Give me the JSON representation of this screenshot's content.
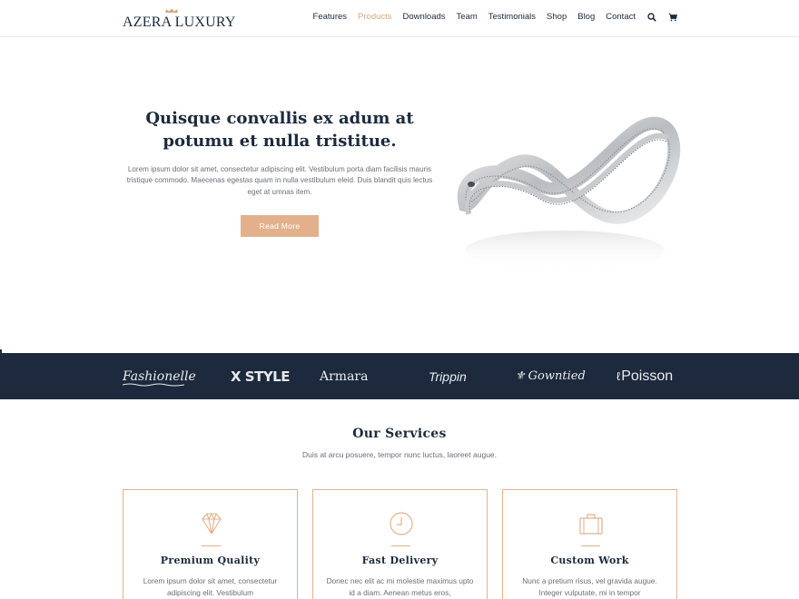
{
  "brand": {
    "logo_text": "AZERA LUXURY",
    "logo_icon": "crown-icon",
    "accent_color": "#e2b18c",
    "navy_color": "#1d2a3d"
  },
  "nav": {
    "items": [
      {
        "label": "Features"
      },
      {
        "label": "Products",
        "active": true
      },
      {
        "label": "Downloads"
      },
      {
        "label": "Team"
      },
      {
        "label": "Testimonials"
      },
      {
        "label": "Shop"
      },
      {
        "label": "Blog"
      },
      {
        "label": "Contact"
      }
    ],
    "search_icon": "search-icon",
    "cart_icon": "cart-icon"
  },
  "hero": {
    "title": "Quisque convallis ex adum at potumu et nulla tristitue.",
    "text": "Lorem ipsum dolor sit amet, consectetur adipiscing elit. Vestibulum porta diam facilisis mauris tristique commodo. Maecenas egestas quam in nulla vestibulum eleid. Duis blandit quis lectus eget at umnas item.",
    "button_label": "Read More",
    "image": "diamond-ring-image"
  },
  "brands": [
    "Fashionelle",
    "X STYLE",
    "Armara",
    "Trippin",
    "Gowntied",
    "Poisson"
  ],
  "services": {
    "title": "Our Services",
    "subtitle": "Duis at arcu posuere, tempor nunc luctus, laoreet augue.",
    "cards": [
      {
        "icon": "diamond-icon",
        "title": "Premium Quality",
        "text": "Lorem ipsum dolor sit amet, consectetur adipiscing elit. Vestibulum"
      },
      {
        "icon": "clock-icon",
        "title": "Fast Delivery",
        "text": "Donec nec elit ac mi molestie maximus upto id a diam. Aenean metus eros,"
      },
      {
        "icon": "briefcase-icon",
        "title": "Custom Work",
        "text": "Nunc a pretium risus, vel gravida augue. Integer vulputate, mi in tempor"
      }
    ]
  }
}
